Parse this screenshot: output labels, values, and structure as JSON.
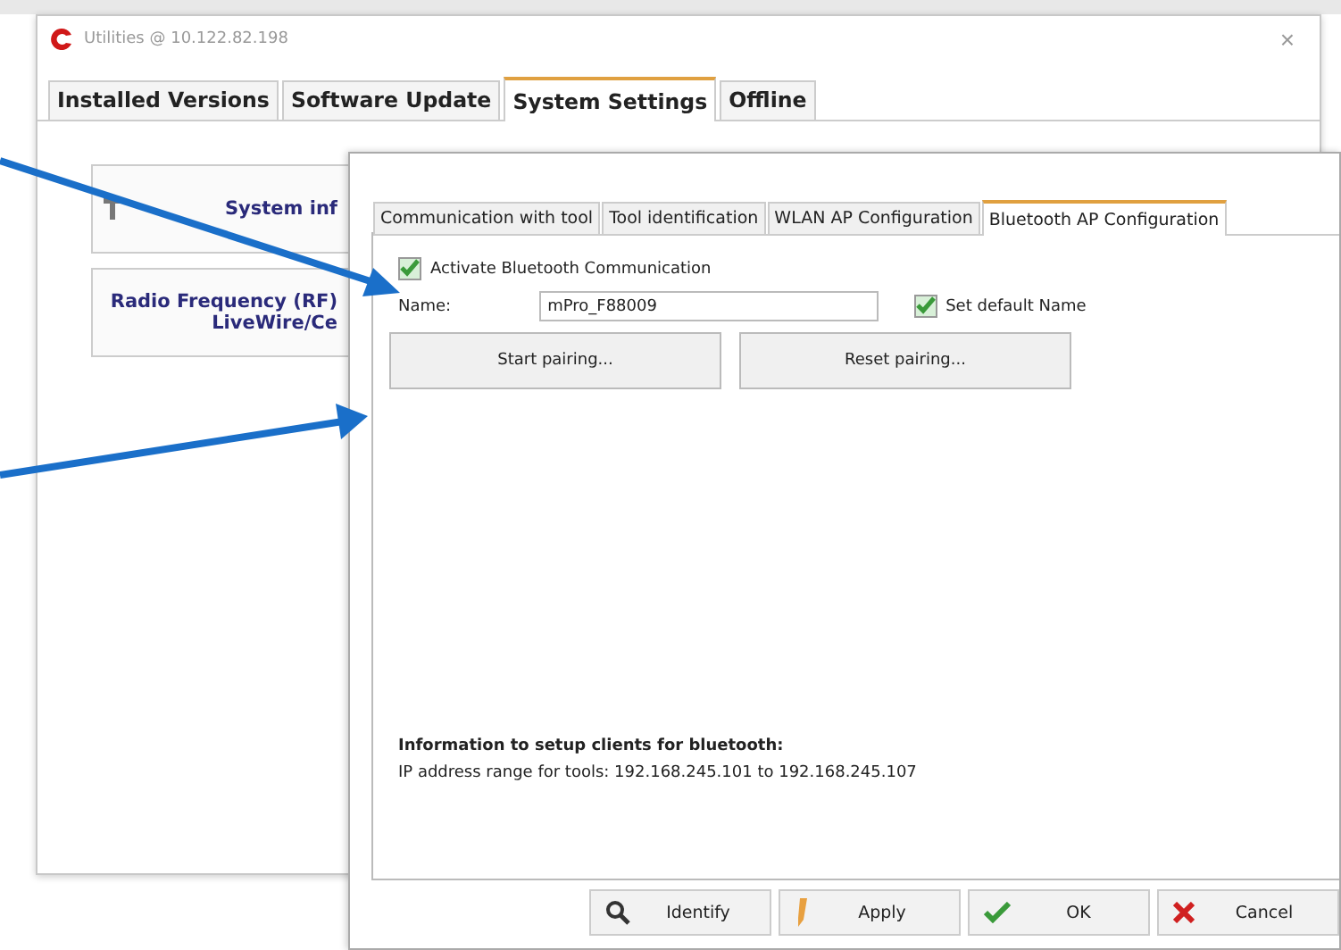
{
  "window": {
    "title": "Utilities @ 10.122.82.198",
    "close": "×"
  },
  "tabs": [
    {
      "label": "Installed Versions",
      "selected": false
    },
    {
      "label": "Software Update",
      "selected": false
    },
    {
      "label": "System Settings",
      "selected": true
    },
    {
      "label": "Offline",
      "selected": false
    }
  ],
  "cards": [
    {
      "kind": "info",
      "lines": [
        "System inf"
      ]
    },
    {
      "kind": "rf",
      "lines": [
        "Radio Frequency (RF)",
        "LiveWire/Ce"
      ]
    }
  ],
  "dialog": {
    "tabs": [
      {
        "label": "Communication with tool",
        "selected": false
      },
      {
        "label": "Tool identification",
        "selected": false
      },
      {
        "label": "WLAN AP Configuration",
        "selected": false
      },
      {
        "label": "Bluetooth AP Configuration",
        "selected": true
      }
    ],
    "activate": {
      "label": "Activate Bluetooth Communication",
      "checked": true
    },
    "name": {
      "label": "Name:",
      "value": "mPro_F88009"
    },
    "default_name": {
      "label": "Set default Name",
      "checked": true
    },
    "actions": [
      "Start pairing...",
      "Reset pairing..."
    ],
    "info_title": "Information to setup clients for bluetooth:",
    "info_text": "IP address range for tools: 192.168.245.101 to 192.168.245.107",
    "buttons": [
      {
        "label": "Identify",
        "kind": "search"
      },
      {
        "label": "Apply",
        "kind": "pencil"
      },
      {
        "label": "OK",
        "kind": "check"
      },
      {
        "label": "Cancel",
        "kind": "cross"
      }
    ]
  }
}
